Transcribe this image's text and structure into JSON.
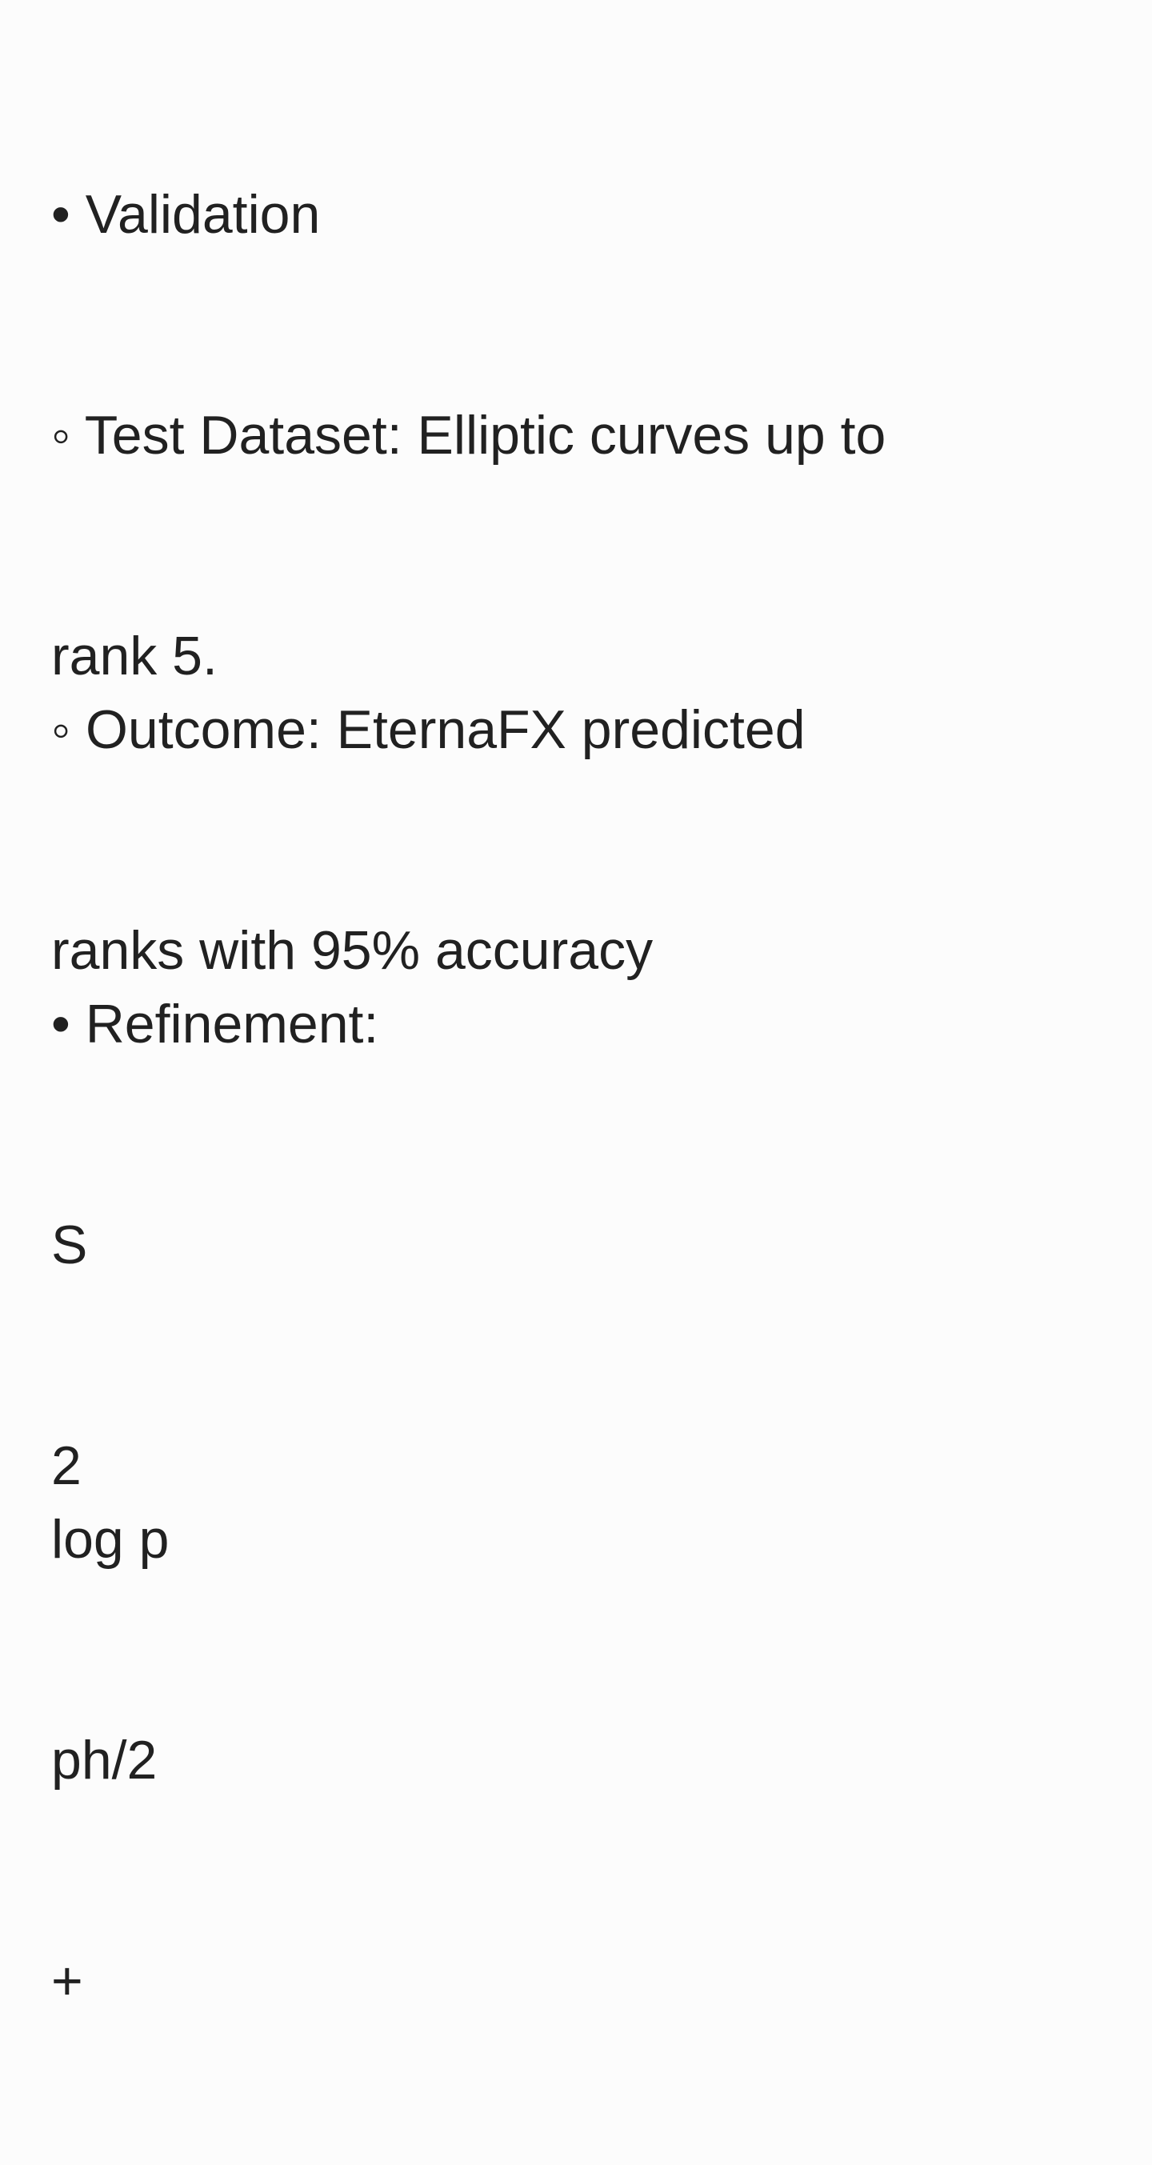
{
  "note": {
    "validation_heading": "• Validation",
    "test_dataset": [
      "◦ Test Dataset: Elliptic curves up to",
      "rank 5."
    ],
    "outcome": [
      "◦ Outcome: EternaFX predicted",
      "ranks with 95% accuracy"
    ],
    "refinement_heading": "• Refinement:",
    "formula_top": [
      "S",
      "2"
    ],
    "formula_bottom": [
      "log p",
      "ph/2",
      "+"
    ]
  }
}
